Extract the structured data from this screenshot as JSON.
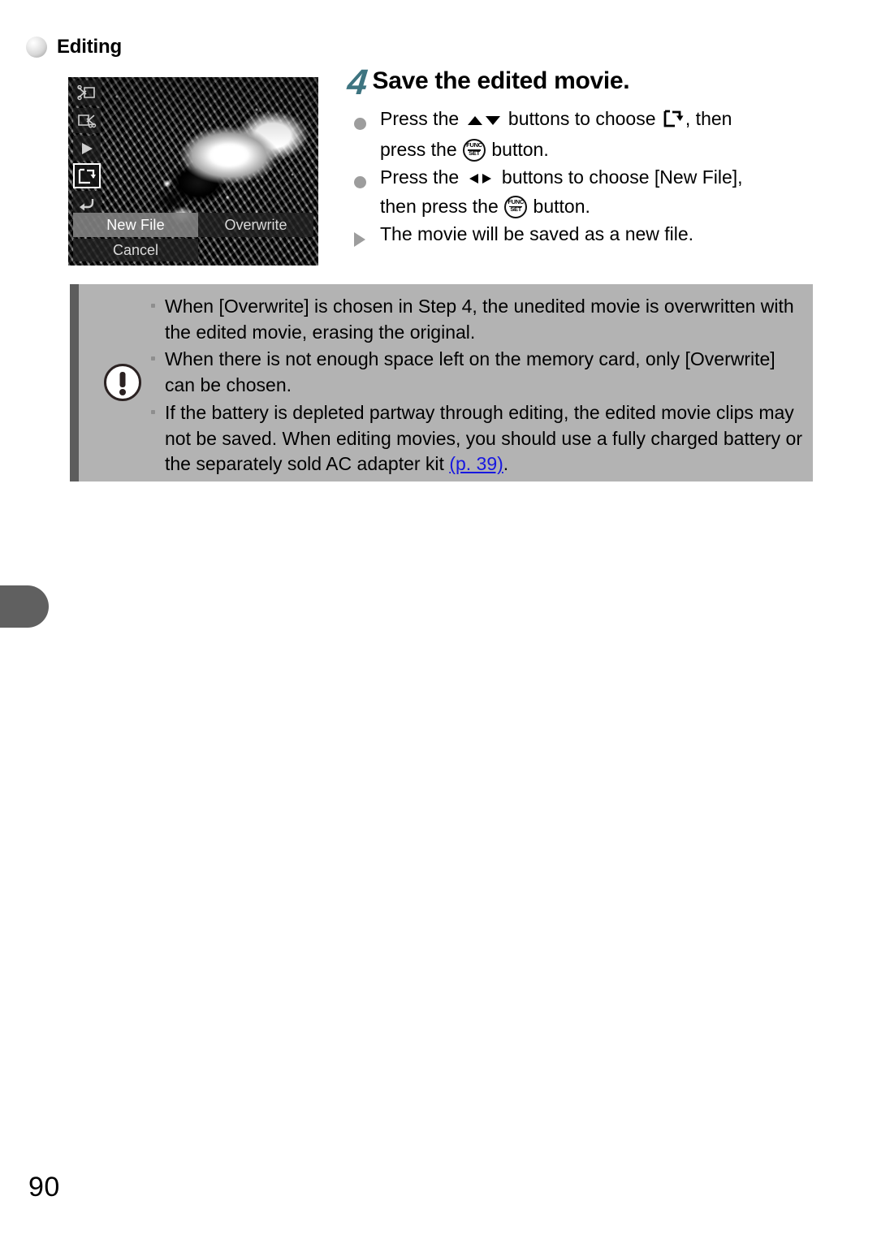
{
  "running_head": {
    "label": "Editing",
    "bullet_icon": "sphere-bullet-icon"
  },
  "camera_screen": {
    "icons": [
      {
        "name": "trim-front-icon",
        "label": "Cut Front"
      },
      {
        "name": "trim-back-icon",
        "label": "Cut Back"
      },
      {
        "name": "play-icon",
        "label": "Play"
      },
      {
        "name": "save-new-file-icon",
        "label": "Save",
        "selected": true
      },
      {
        "name": "return-icon",
        "label": "Return"
      }
    ],
    "menu": {
      "new_file": "New File",
      "overwrite": "Overwrite",
      "cancel": "Cancel",
      "selected": "New File"
    },
    "photo_alt": "Black and white photo of a papillon dog lying in foliage"
  },
  "step": {
    "number": "4",
    "number_color": "#3d7480",
    "title": "Save the edited movie.",
    "bullets": [
      {
        "marker": "dot",
        "segments": [
          {
            "type": "text",
            "value": "Press the "
          },
          {
            "type": "icon",
            "name": "up-down-buttons-icon"
          },
          {
            "type": "text",
            "value": " buttons to choose "
          },
          {
            "type": "icon",
            "name": "save-new-file-icon"
          },
          {
            "type": "text",
            "value": ", then"
          }
        ],
        "continuation": [
          {
            "type": "text",
            "value": "press the "
          },
          {
            "type": "icon",
            "name": "func-set-button-icon"
          },
          {
            "type": "text",
            "value": " button."
          }
        ]
      },
      {
        "marker": "dot",
        "segments": [
          {
            "type": "text",
            "value": "Press the "
          },
          {
            "type": "icon",
            "name": "left-right-buttons-icon"
          },
          {
            "type": "text",
            "value": " buttons to choose [New File],"
          }
        ],
        "continuation": [
          {
            "type": "text",
            "value": "then press the "
          },
          {
            "type": "icon",
            "name": "func-set-button-icon"
          },
          {
            "type": "text",
            "value": " button."
          }
        ]
      },
      {
        "marker": "triangle",
        "segments": [
          {
            "type": "text",
            "value": "The movie will be saved as a new file."
          }
        ]
      }
    ]
  },
  "caution": {
    "icon": "exclamation-circle-icon",
    "items": [
      "When [Overwrite] is chosen in Step 4, the unedited movie is overwritten with the edited movie, erasing the original.",
      "When there is not enough space left on the memory card, only [Overwrite] can be chosen.",
      "If the battery is depleted partway through editing, the edited movie clips may not be saved. When editing movies, you should use a fully charged battery or the separately sold AC adapter kit "
    ],
    "link_text": "(p. 39)",
    "link_suffix": ".",
    "link_color": "#1818e0"
  },
  "chapter_tab": {
    "color": "#606060"
  },
  "page_number": "90"
}
